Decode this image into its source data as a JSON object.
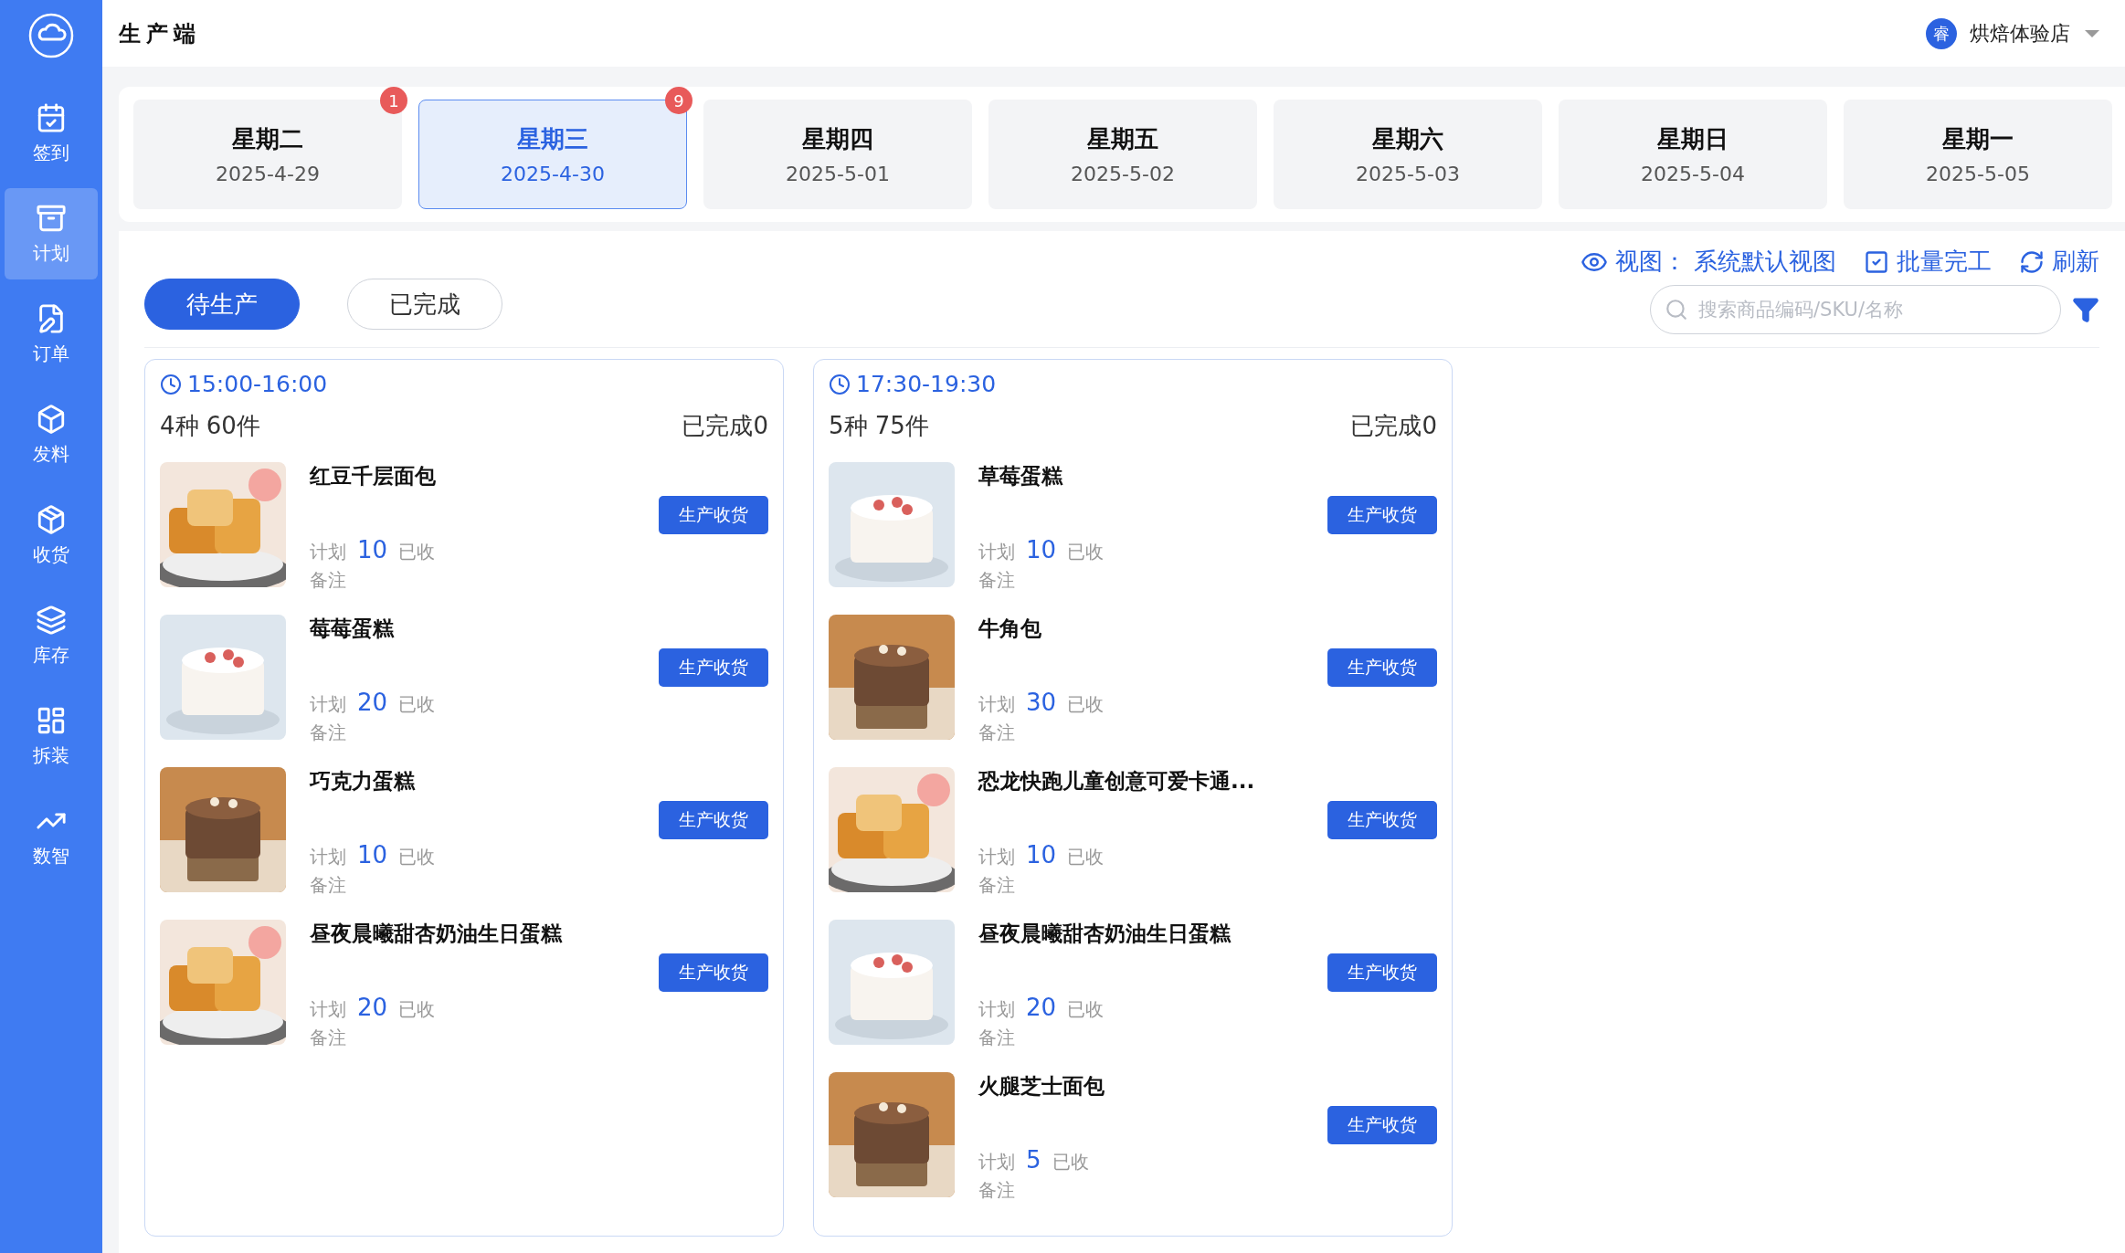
{
  "app": {
    "title": "生产端"
  },
  "store": {
    "avatar": "睿",
    "name": "烘焙体验店"
  },
  "sidebar": {
    "items": [
      {
        "kind": "checkin",
        "label": "签到",
        "selected": false
      },
      {
        "kind": "plan",
        "label": "计划",
        "selected": true
      },
      {
        "kind": "order",
        "label": "订单",
        "selected": false
      },
      {
        "kind": "material",
        "label": "发料",
        "selected": false
      },
      {
        "kind": "receive",
        "label": "收货",
        "selected": false
      },
      {
        "kind": "stock",
        "label": "库存",
        "selected": false
      },
      {
        "kind": "split",
        "label": "拆装",
        "selected": false
      },
      {
        "kind": "data",
        "label": "数智",
        "selected": false
      }
    ]
  },
  "days": [
    {
      "weekday": "星期二",
      "date": "2025-4-29",
      "selected": false,
      "badge": "1"
    },
    {
      "weekday": "星期三",
      "date": "2025-4-30",
      "selected": true,
      "badge": "9"
    },
    {
      "weekday": "星期四",
      "date": "2025-5-01",
      "selected": false
    },
    {
      "weekday": "星期五",
      "date": "2025-5-02",
      "selected": false
    },
    {
      "weekday": "星期六",
      "date": "2025-5-03",
      "selected": false
    },
    {
      "weekday": "星期日",
      "date": "2025-5-04",
      "selected": false
    },
    {
      "weekday": "星期一",
      "date": "2025-5-05",
      "selected": false
    }
  ],
  "status_tabs": [
    {
      "label": "待生产",
      "selected": true
    },
    {
      "label": "已完成",
      "selected": false
    }
  ],
  "toolbar": {
    "view_label": "视图：",
    "view_name": "系统默认视图",
    "batch": "批量完工",
    "refresh": "刷新"
  },
  "search": {
    "placeholder": "搜索商品编码/SKU/名称"
  },
  "slots": [
    {
      "time": "15:00-16:00",
      "summary": "4种 60件",
      "done": "已完成0",
      "items": [
        {
          "name": "红豆千层面包",
          "plan_label": "计划",
          "plan": "10",
          "received_label": "已收",
          "note_label": "备注",
          "button": "生产收货"
        },
        {
          "name": "莓莓蛋糕",
          "plan_label": "计划",
          "plan": "20",
          "received_label": "已收",
          "note_label": "备注",
          "button": "生产收货"
        },
        {
          "name": "巧克力蛋糕",
          "plan_label": "计划",
          "plan": "10",
          "received_label": "已收",
          "note_label": "备注",
          "button": "生产收货"
        },
        {
          "name": "昼夜晨曦甜杏奶油生日蛋糕",
          "plan_label": "计划",
          "plan": "20",
          "received_label": "已收",
          "note_label": "备注",
          "button": "生产收货"
        }
      ]
    },
    {
      "time": "17:30-19:30",
      "summary": "5种 75件",
      "done": "已完成0",
      "items": [
        {
          "name": "草莓蛋糕",
          "plan_label": "计划",
          "plan": "10",
          "received_label": "已收",
          "note_label": "备注",
          "button": "生产收货"
        },
        {
          "name": "牛角包",
          "plan_label": "计划",
          "plan": "30",
          "received_label": "已收",
          "note_label": "备注",
          "button": "生产收货"
        },
        {
          "name": "恐龙快跑儿童创意可爱卡通...",
          "plan_label": "计划",
          "plan": "10",
          "received_label": "已收",
          "note_label": "备注",
          "button": "生产收货"
        },
        {
          "name": "昼夜晨曦甜杏奶油生日蛋糕",
          "plan_label": "计划",
          "plan": "20",
          "received_label": "已收",
          "note_label": "备注",
          "button": "生产收货"
        },
        {
          "name": "火腿芝士面包",
          "plan_label": "计划",
          "plan": "5",
          "received_label": "已收",
          "note_label": "备注",
          "button": "生产收货"
        }
      ]
    }
  ]
}
